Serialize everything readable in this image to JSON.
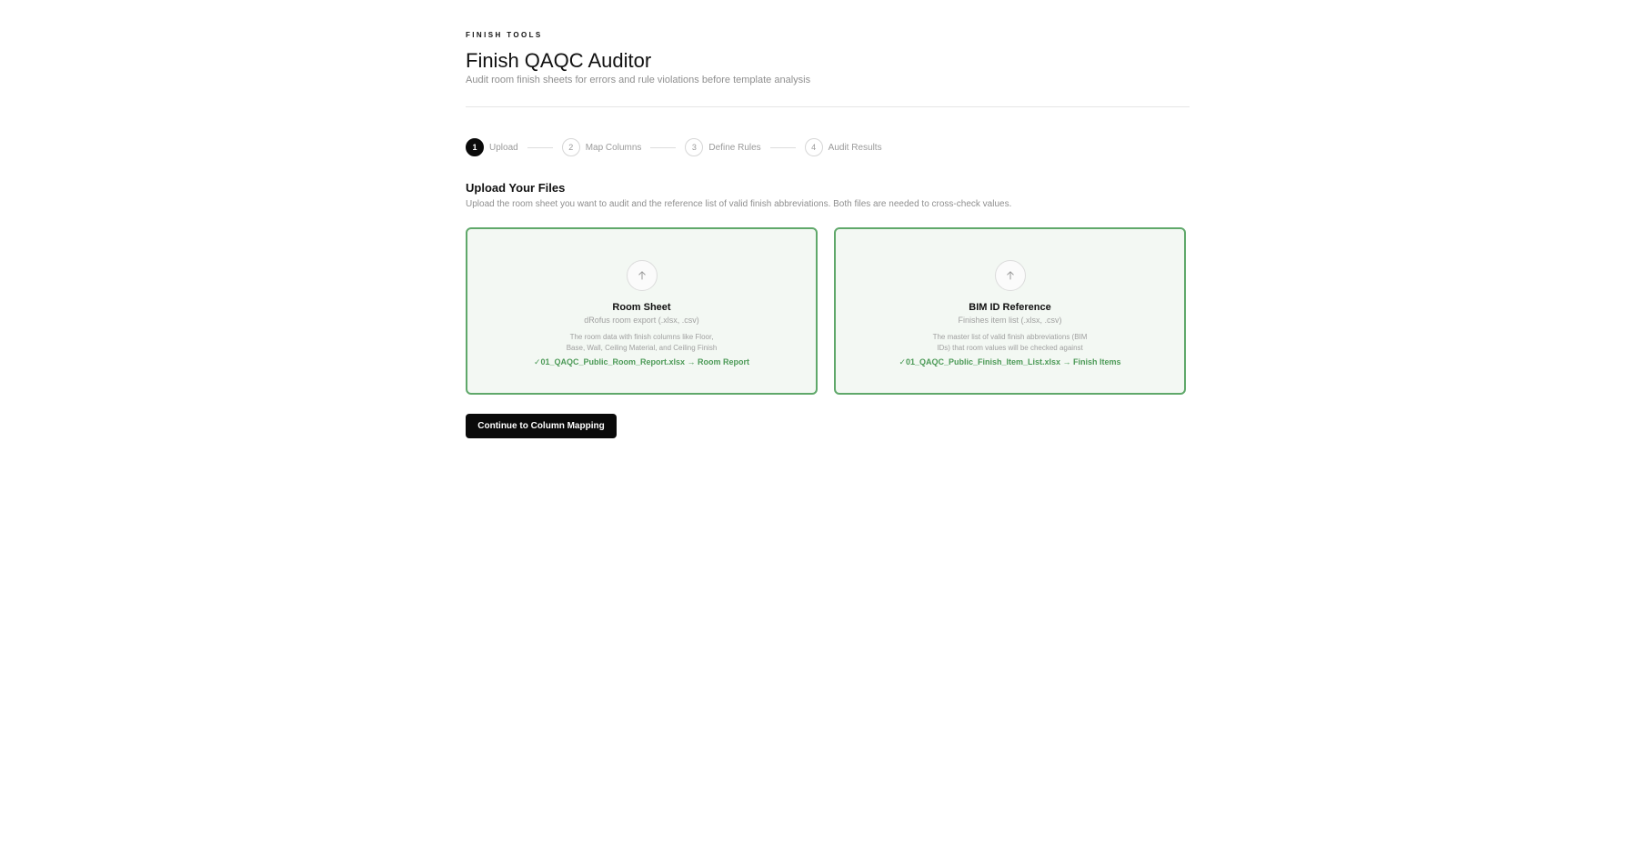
{
  "header": {
    "eyebrow": "FINISH TOOLS",
    "title": "Finish QAQC Auditor",
    "subtitle": "Audit room finish sheets for errors and rule violations before template analysis"
  },
  "stepper": {
    "active_step": 1,
    "steps": [
      {
        "number": "1",
        "label": "Upload"
      },
      {
        "number": "2",
        "label": "Map Columns"
      },
      {
        "number": "3",
        "label": "Define Rules"
      },
      {
        "number": "4",
        "label": "Audit Results"
      }
    ]
  },
  "upload": {
    "title": "Upload Your Files",
    "description": "Upload the room sheet you want to audit and the reference list of valid finish abbreviations. Both files are needed to cross-check values.",
    "cards": [
      {
        "icon": "upload-arrow-icon",
        "title": "Room Sheet",
        "subtitle": "dRofus room export (.xlsx, .csv)",
        "description": "The room data with finish columns like Floor, Base, Wall, Ceiling Material, and Ceiling Finish",
        "file_status": "✓01_QAQC_Public_Room_Report.xlsx → Room Report"
      },
      {
        "icon": "upload-arrow-icon",
        "title": "BIM ID Reference",
        "subtitle": "Finishes item list (.xlsx, .csv)",
        "description": "The master list of valid finish abbreviations (BIM IDs) that room values will be checked against",
        "file_status": "✓01_QAQC_Public_Finish_Item_List.xlsx → Finish Items"
      }
    ]
  },
  "actions": {
    "continue_label": "Continue to Column Mapping"
  },
  "colors": {
    "accent_green": "#5fa86a",
    "success_text": "#4c9a57",
    "card_bg": "#f3f8f3",
    "primary_button": "#0a0a0a"
  }
}
